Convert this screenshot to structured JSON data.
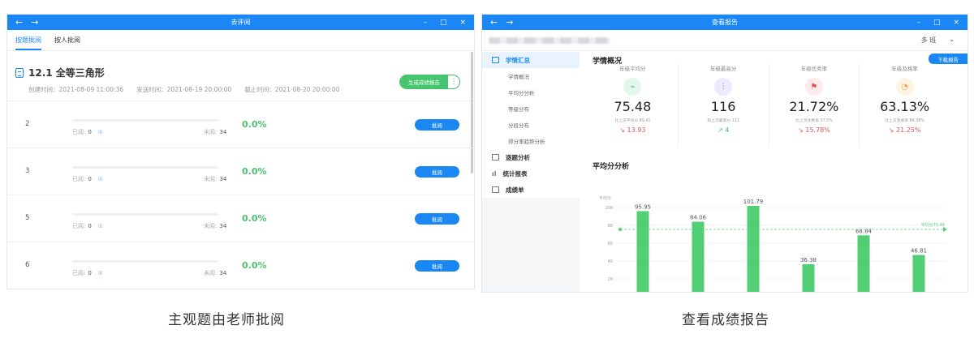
{
  "left": {
    "title": "去评阅",
    "tabs": [
      "按题批阅",
      "按人批阅"
    ],
    "exam_title": "12.1 全等三角形",
    "meta": [
      "创建时间：2021-08-09 11:00:36",
      "发送时间：2021-08-19 20:00:00",
      "截止时间：2021-08-20 20:00:00"
    ],
    "gen_button": "生成成绩报告",
    "read_label": "已阅:",
    "unread_label": "未阅:",
    "mark_button": "批阅",
    "questions": [
      {
        "no": "2",
        "read": "0",
        "unread": "34",
        "pct": "0.0%"
      },
      {
        "no": "3",
        "read": "0",
        "unread": "34",
        "pct": "0.0%"
      },
      {
        "no": "5",
        "read": "0",
        "unread": "34",
        "pct": "0.0%"
      },
      {
        "no": "6",
        "read": "0",
        "unread": "34",
        "pct": "0.0%"
      }
    ]
  },
  "right": {
    "title": "查看报告",
    "lang": "多 班",
    "download": "下载报告",
    "menu": {
      "summary": "学情汇总",
      "summary_items": [
        "学情概况",
        "平均分分析",
        "等级分布",
        "分段分布",
        "得分率趋势分析"
      ],
      "question_analysis": "逐题分析",
      "stats_table": "统计报表",
      "score_sheet": "成绩单"
    },
    "overview_title": "学情概况",
    "stats": [
      {
        "label": "年级平均分",
        "value": "75.48",
        "compare": "比上次平均分 89.41",
        "change": "↘ 13.93",
        "color": "#4ac36f",
        "bg": "#e4f7eb",
        "icon": "pulse-icon",
        "glyph": "⌁",
        "trend": "#e25454"
      },
      {
        "label": "年级最高分",
        "value": "116",
        "compare": "和上次最高分 112",
        "change": "↗ 4",
        "color": "#7a6ff0",
        "bg": "#ecebfd",
        "icon": "bar-icon",
        "glyph": "⫶",
        "trend": "#4ac36f"
      },
      {
        "label": "年级优秀率",
        "value": "21.72%",
        "compare": "比上次优秀率 37.5%",
        "change": "↘ 15.78%",
        "color": "#e25454",
        "bg": "#fdeaea",
        "icon": "flag-icon",
        "glyph": "⚑",
        "trend": "#e25454"
      },
      {
        "label": "年级及格率",
        "value": "63.13%",
        "compare": "比上次及格率 84.38%",
        "change": "↘ 21.25%",
        "color": "#f0a640",
        "bg": "#fdf3e3",
        "icon": "clock-icon",
        "glyph": "◔",
        "trend": "#e25454"
      }
    ],
    "avg_title": "平均分分析"
  },
  "chart_data": {
    "type": "bar",
    "ylabel": "平均分",
    "ylim": [
      0,
      100
    ],
    "yticks": [
      0,
      20,
      40,
      60,
      80,
      100
    ],
    "values": [
      95.95,
      84.06,
      101.79,
      36.38,
      68.84,
      46.81
    ],
    "reference_line": {
      "label": "平均分75.48",
      "value": 75.48
    },
    "bar_color": "#52cf74"
  },
  "captions": {
    "left": "主观题由老师批阅",
    "right": "查看成绩报告"
  }
}
